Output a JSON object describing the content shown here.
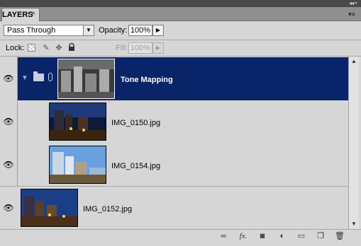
{
  "panel": {
    "tab_label": "LAYERS",
    "tab_close_glyph": "×",
    "collapse_glyph": "◂◂ ×",
    "menu_glyph": "▾≡"
  },
  "blend_mode": {
    "value": "Pass Through",
    "arrow": "▼"
  },
  "opacity": {
    "label": "Opacity:",
    "value": "100%",
    "arrow": "▶"
  },
  "lock": {
    "label": "Lock:",
    "icons": [
      "transparent-pixels-icon",
      "brush-icon",
      "move-icon",
      "lock-icon"
    ]
  },
  "fill": {
    "label": "Fill:",
    "value": "100%",
    "arrow": "▶"
  },
  "layers": [
    {
      "name": "Tone Mapping",
      "type": "group",
      "selected": true,
      "visible": true
    },
    {
      "name": "IMG_0150.jpg",
      "type": "layer",
      "visible": true
    },
    {
      "name": "IMG_0154.jpg",
      "type": "layer",
      "visible": true
    },
    {
      "name": "IMG_0152.jpg",
      "type": "layer",
      "visible": true
    }
  ],
  "bottom_tools": [
    {
      "icon": "link-layers-icon",
      "glyph": "∞"
    },
    {
      "icon": "fx-icon",
      "glyph": "fx."
    },
    {
      "icon": "layer-mask-icon",
      "glyph": "◙"
    },
    {
      "icon": "adjustment-layer-icon",
      "glyph": "◐"
    },
    {
      "icon": "new-group-icon",
      "glyph": "▭"
    },
    {
      "icon": "new-layer-icon",
      "glyph": "❐"
    },
    {
      "icon": "trash-icon",
      "glyph": "🗑"
    }
  ],
  "colors": {
    "selection": "#0a246a",
    "panel_bg": "#d6d6d6"
  }
}
